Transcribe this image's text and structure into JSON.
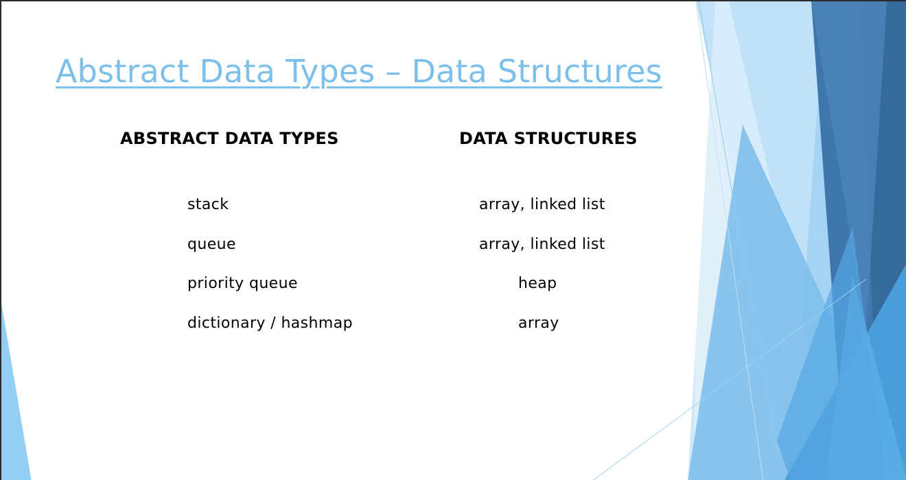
{
  "slide": {
    "title": "Abstract Data Types – Data Structures",
    "title_color": "#7cc0ea",
    "columns": {
      "left_header": "ABSTRACT DATA TYPES",
      "right_header": "DATA STRUCTURES"
    },
    "rows": [
      {
        "adt": "stack",
        "structure": "array, linked list"
      },
      {
        "adt": "queue",
        "structure": "array, linked list"
      },
      {
        "adt": "priority queue",
        "structure": "heap"
      },
      {
        "adt": "dictionary / hashmap",
        "structure": "array"
      }
    ]
  },
  "theme": {
    "light_blue": "#9fd1f2",
    "mid_blue": "#5ab0e6",
    "dark_blue": "#3a6ea3"
  }
}
